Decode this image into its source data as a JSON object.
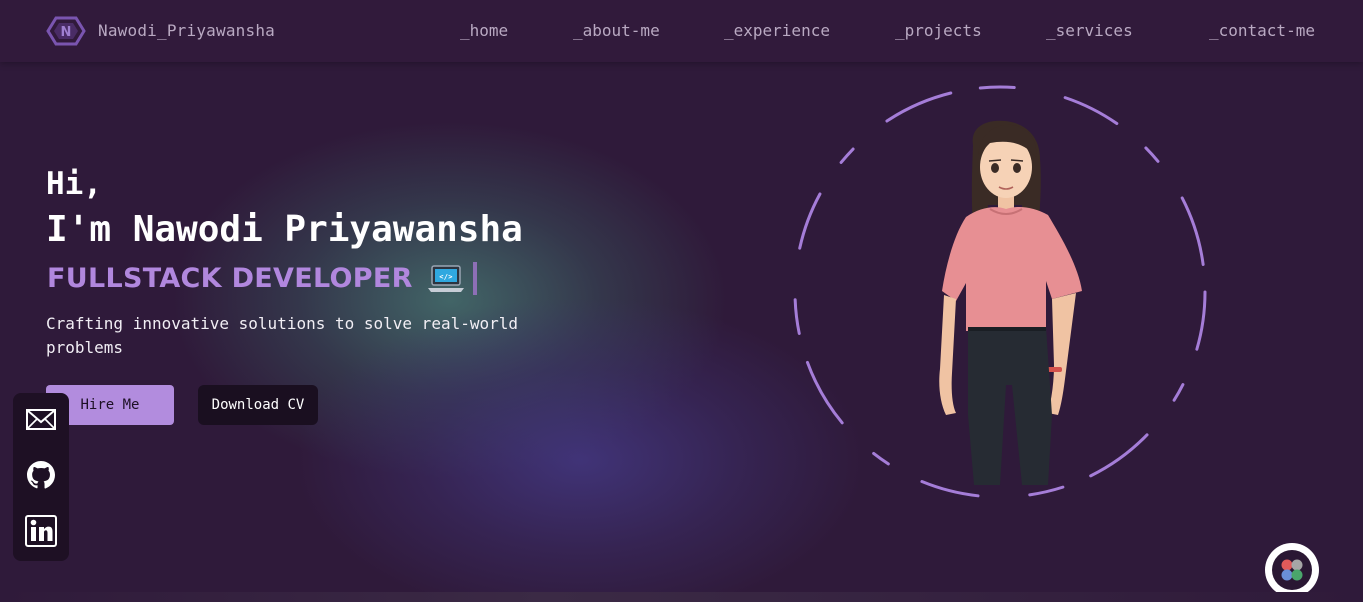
{
  "header": {
    "brand": "Nawodi_Priyawansha",
    "logo_icon": "n-hexagon-logo-icon",
    "nav": [
      "_home",
      "_about-me",
      "_experience",
      "_projects",
      "_services",
      "_contact-me"
    ]
  },
  "hero": {
    "greeting": "Hi,",
    "name": "I'm Nawodi Priyawansha",
    "role": "FULLSTACK DEVELOPER",
    "role_icon": "laptop-code-icon",
    "tagline": "Crafting innovative solutions to solve real-world problems",
    "hire_label": "Hire Me",
    "cv_label": "Download CV",
    "illustration": "developer-girl-illustration"
  },
  "social": [
    "mail-icon",
    "github-icon",
    "linkedin-icon"
  ],
  "floating_button_icon": "four-petal-icon",
  "colors": {
    "background": "#2f1a3a",
    "accent": "#b187de",
    "nav_text": "#b9a9c2",
    "button_primary": "#b28cde",
    "button_dark": "#1a0f20"
  }
}
